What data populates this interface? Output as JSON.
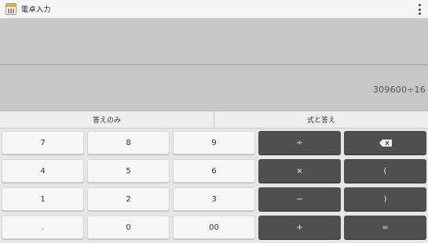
{
  "app": {
    "title": "電卓入力",
    "menu_icon": "overflow-menu-icon"
  },
  "display": {
    "expression": "309600÷16"
  },
  "modes": {
    "answer_only": "答えのみ",
    "expression_and_answer": "式と答え"
  },
  "keys": {
    "seven": "7",
    "eight": "8",
    "nine": "9",
    "divide": "÷",
    "four": "4",
    "five": "5",
    "six": "6",
    "multiply": "×",
    "paren_open": "(",
    "one": "1",
    "two": "2",
    "three": "3",
    "minus": "−",
    "paren_close": ")",
    "dot": ".",
    "zero": "0",
    "double_zero": "00",
    "plus": "+",
    "equals": "=",
    "backspace_icon": "backspace-icon"
  },
  "colors": {
    "display_bg": "#c6c6c6",
    "number_key": "#f6f6f6",
    "operator_key": "#4f4f4f"
  }
}
